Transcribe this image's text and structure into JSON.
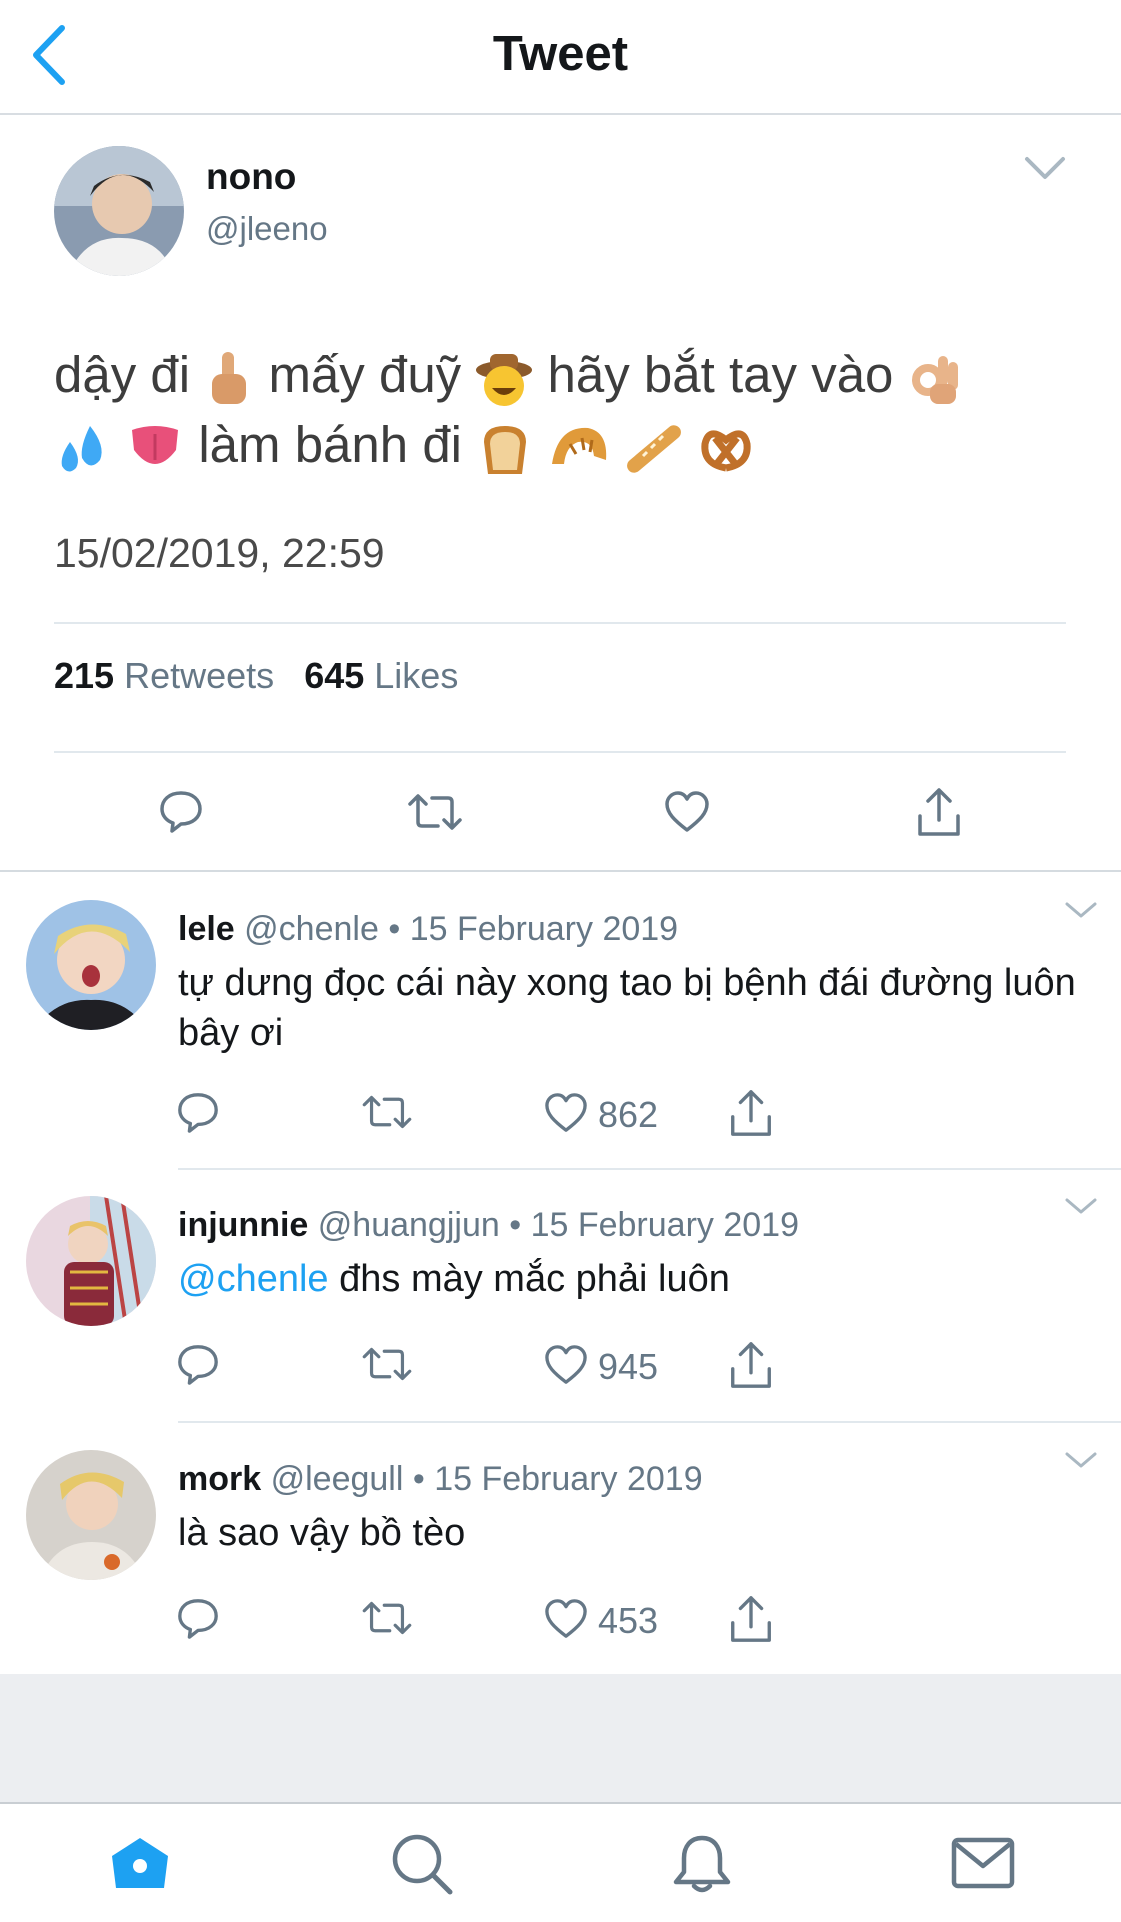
{
  "header": {
    "title": "Tweet"
  },
  "tweet": {
    "name": "nono",
    "handle": "@jleeno",
    "text_line1_a": "dậy đi",
    "text_line1_b": "mấy đuỹ",
    "text_line1_c": "hãy bắt tay vào",
    "text_line2": "làm bánh đi",
    "timestamp": "15/02/2019, 22:59",
    "retweets_count": "215",
    "retweets_label": "Retweets",
    "likes_count": "645",
    "likes_label": "Likes"
  },
  "replies": [
    {
      "name": "lele",
      "handle": "@chenle",
      "date": "• 15 February 2019",
      "text": "tự dưng đọc cái này xong tao bị bệnh đái đường luôn bây ơi",
      "likes": "862"
    },
    {
      "name": "injunnie",
      "handle": "@huangjjun",
      "date": "• 15 February 2019",
      "mention": "@chenle",
      "text": "đhs mày mắc phải luôn",
      "likes": "945"
    },
    {
      "name": "mork",
      "handle": "@leegull",
      "date": "• 15 February 2019",
      "text": "là sao vậy bồ tèo",
      "likes": "453"
    }
  ],
  "icons": {
    "back": "chevron-left-icon",
    "reply": "reply-icon",
    "retweet": "retweet-icon",
    "like": "heart-icon",
    "share": "share-icon",
    "home": "home-icon",
    "search": "search-icon",
    "notifications": "bell-icon",
    "messages": "mail-icon"
  },
  "colors": {
    "accent": "#1da1f2",
    "text": "#14171a",
    "muted": "#657786",
    "tab_active": "#1da1f2"
  }
}
